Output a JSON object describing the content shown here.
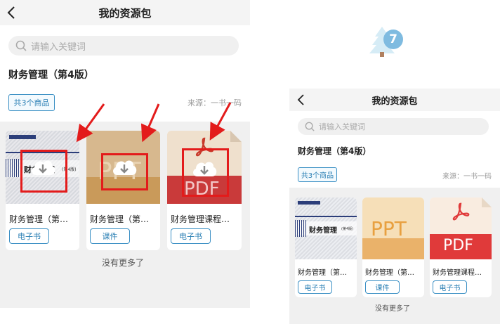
{
  "page": {
    "title": "我的资源包",
    "search_placeholder": "请输入关键词",
    "book_title": "财务管理（第4版）",
    "count_label": "共3个商品",
    "source_label": "来源：一书一码",
    "more_label": "没有更多了"
  },
  "items": [
    {
      "name": "财务管理（第…",
      "tag": "电子书",
      "cover": "ebook-cover"
    },
    {
      "name": "财务管理（第…",
      "tag": "课件",
      "cover": "ppt-cover"
    },
    {
      "name": "财务管理课程…",
      "tag": "电子书",
      "cover": "pdf-cover"
    }
  ],
  "covers": {
    "ebook_title": "财务管理",
    "ebook_edition": "(第4版)",
    "ppt_text": "PPT",
    "pdf_text": "PDF"
  },
  "overlay": {
    "badge_text": "7"
  },
  "colors": {
    "accent": "#2a7fb4",
    "highlight": "#e31b1b",
    "pdf_red": "#e03a3a",
    "ppt_orange": "#e8a040"
  }
}
